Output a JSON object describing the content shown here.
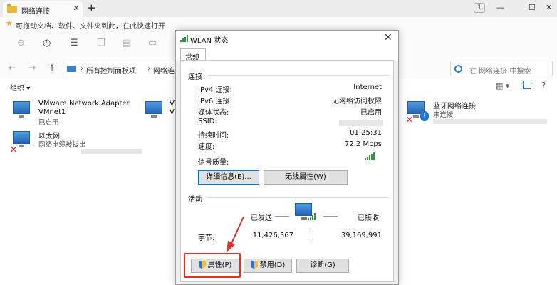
{
  "explorer": {
    "tab_title": "网络连接",
    "tab_close": "✕",
    "new_tab": "+",
    "window_badge": "1",
    "win_min": "—",
    "win_max": "☐",
    "win_close": "✕",
    "favorites_text": "可拖动文档、软件、文件夹到此，在此快速打开",
    "breadcrumb": [
      "所有控制面板项",
      "网络连接"
    ],
    "search_placeholder": "在 网络连接 中搜索",
    "organize_label": "组织 ▾"
  },
  "network_items": [
    {
      "name": "VMware Network Adapter",
      "name2": "VMnet1",
      "status": "已启用"
    },
    {
      "name": "以太网",
      "status": "网络电缆被拔出"
    },
    {
      "name": "V",
      "name2": "V",
      "status": ""
    },
    {
      "name": "蓝牙网络连接",
      "status": "未连接"
    }
  ],
  "dialog": {
    "title": "WLAN 状态",
    "close": "✕",
    "tab": "常规",
    "connection_section": "连接",
    "fields": [
      {
        "label": "IPv4 连接:",
        "value": "Internet"
      },
      {
        "label": "IPv6 连接:",
        "value": "无网络访问权限"
      },
      {
        "label": "媒体状态:",
        "value": "已启用"
      },
      {
        "label": "SSID:",
        "value": ""
      },
      {
        "label": "持续时间:",
        "value": "01:25:31"
      },
      {
        "label": "速度:",
        "value": "72.2 Mbps"
      }
    ],
    "signal_label": "信号质量:",
    "details_button": "详细信息(E)...",
    "wireless_props_button": "无线属性(W)",
    "activity_section": "活动",
    "sent_label": "已发送",
    "received_label": "已接收",
    "bytes_label": "字节:",
    "bytes_sent": "11,426,367",
    "bytes_received": "39,169,991",
    "properties_button": "属性(P)",
    "disable_button": "禁用(D)",
    "diagnose_button": "诊断(G)"
  },
  "colors": {
    "accent": "#0078d7",
    "highlight": "#e03030",
    "signal": "#2a9d3a"
  }
}
